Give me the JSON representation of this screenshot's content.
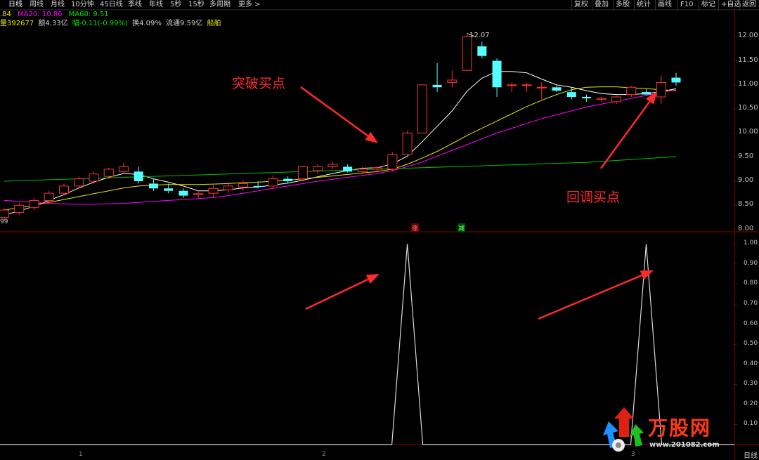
{
  "toolbar": {
    "tabs": [
      "日线",
      "周线",
      "月线",
      "10分钟",
      "45日线",
      "季线",
      "年线",
      "5秒",
      "15秒",
      "多周期",
      "更多 >"
    ],
    "buttons": [
      "复权",
      "叠加",
      "多股",
      "统计",
      "画线",
      "F10",
      "标记",
      "+自选",
      "返回"
    ]
  },
  "ma_row": {
    "ma10": ".84",
    "ma20": "MA20: 10.86",
    "ma60": "MA60: 9.51"
  },
  "info_row": {
    "volume": "量392677",
    "amount": "额4.33亿",
    "change": "幅-0.11(-0.99%)",
    "turnover": "换4.09%",
    "float": "流通9.59亿",
    "sector": "船舶"
  },
  "price_axis": [
    "12.00",
    "11.50",
    "11.00",
    "10.50",
    "10.00",
    "9.50",
    "9.00",
    "8.50",
    "8.00"
  ],
  "indicator_axis": [
    "1.00",
    "0.90",
    "0.80",
    "0.70",
    "0.60",
    "0.50",
    "0.40",
    "0.30",
    "0.20",
    "0.10"
  ],
  "annotations": {
    "breakout": "突破买点",
    "pullback": "回调买点",
    "high": "12.07",
    "low_left": "99"
  },
  "markers": {
    "zhang": "涨",
    "jian": "减"
  },
  "x_ticks": [
    "1",
    "2",
    "3"
  ],
  "period_label": "日线",
  "watermark": {
    "brand": "万股网",
    "url": "www.201082.com"
  },
  "chart_data": [
    {
      "type": "candlestick",
      "title": "",
      "series": [
        {
          "name": "candles",
          "ohlc": [
            [
              8.25,
              8.45,
              8.2,
              8.4
            ],
            [
              8.35,
              8.55,
              8.3,
              8.5
            ],
            [
              8.45,
              8.65,
              8.4,
              8.6
            ],
            [
              8.6,
              8.8,
              8.55,
              8.75
            ],
            [
              8.75,
              8.95,
              8.7,
              8.9
            ],
            [
              8.9,
              9.1,
              8.85,
              9.05
            ],
            [
              9.0,
              9.2,
              8.95,
              9.15
            ],
            [
              9.1,
              9.28,
              9.05,
              9.25
            ],
            [
              9.2,
              9.38,
              9.15,
              9.3
            ],
            [
              9.2,
              9.3,
              8.95,
              9.0
            ],
            [
              8.95,
              9.05,
              8.8,
              8.85
            ],
            [
              8.85,
              8.95,
              8.75,
              8.8
            ],
            [
              8.8,
              8.85,
              8.65,
              8.7
            ],
            [
              8.72,
              8.8,
              8.65,
              8.74
            ],
            [
              8.75,
              8.92,
              8.65,
              8.85
            ],
            [
              8.82,
              8.98,
              8.75,
              8.9
            ],
            [
              8.88,
              9.02,
              8.8,
              8.95
            ],
            [
              8.9,
              9.0,
              8.85,
              8.88
            ],
            [
              8.9,
              9.12,
              8.85,
              9.05
            ],
            [
              9.05,
              9.1,
              8.95,
              9.0
            ],
            [
              9.05,
              9.32,
              9.0,
              9.3
            ],
            [
              9.22,
              9.35,
              9.15,
              9.3
            ],
            [
              9.3,
              9.4,
              9.25,
              9.35
            ],
            [
              9.3,
              9.35,
              9.18,
              9.2
            ],
            [
              9.2,
              9.3,
              9.15,
              9.25
            ],
            [
              9.25,
              9.3,
              9.2,
              9.28
            ],
            [
              9.25,
              9.6,
              9.2,
              9.55
            ],
            [
              9.55,
              10.05,
              9.55,
              10.0
            ],
            [
              10.0,
              11.0,
              10.0,
              11.0
            ],
            [
              11.0,
              11.45,
              10.85,
              10.95
            ],
            [
              11.05,
              11.3,
              10.95,
              11.1
            ],
            [
              11.3,
              12.07,
              11.3,
              12.0
            ],
            [
              11.8,
              11.9,
              11.55,
              11.6
            ],
            [
              11.5,
              11.55,
              10.75,
              10.95
            ],
            [
              11.0,
              11.05,
              10.85,
              11.0
            ],
            [
              11.0,
              11.05,
              10.85,
              11.0
            ],
            [
              10.95,
              11.05,
              10.7,
              10.95
            ],
            [
              10.95,
              10.98,
              10.85,
              10.88
            ],
            [
              10.85,
              10.95,
              10.7,
              10.75
            ],
            [
              10.75,
              10.8,
              10.65,
              10.72
            ],
            [
              10.7,
              10.75,
              10.65,
              10.72
            ],
            [
              10.65,
              10.78,
              10.6,
              10.75
            ],
            [
              10.8,
              10.98,
              10.75,
              10.95
            ],
            [
              10.85,
              10.92,
              10.78,
              10.8
            ],
            [
              10.75,
              11.2,
              10.6,
              11.05
            ],
            [
              11.15,
              11.25,
              10.98,
              11.05
            ]
          ]
        },
        {
          "name": "MA5",
          "values": [
            8.3,
            8.38,
            8.48,
            8.6,
            8.72,
            8.86,
            8.98,
            9.08,
            9.16,
            9.14,
            9.05,
            8.98,
            8.9,
            8.8,
            8.8,
            8.82,
            8.86,
            8.88,
            8.92,
            8.96,
            9.02,
            9.09,
            9.16,
            9.22,
            9.27,
            9.28,
            9.36,
            9.52,
            9.82,
            10.14,
            10.46,
            10.87,
            11.14,
            11.28,
            11.28,
            11.25,
            11.12,
            11.0,
            10.95,
            10.88,
            10.82,
            10.8,
            10.8,
            10.82,
            10.86,
            10.92
          ]
        },
        {
          "name": "MA20",
          "values": [
            8.4,
            8.45,
            8.5,
            8.56,
            8.62,
            8.68,
            8.74,
            8.8,
            8.86,
            8.9,
            8.92,
            8.93,
            8.93,
            8.93,
            8.94,
            8.95,
            8.97,
            8.98,
            9.0,
            9.02,
            9.05,
            9.08,
            9.11,
            9.14,
            9.17,
            9.2,
            9.25,
            9.35,
            9.48,
            9.62,
            9.78,
            9.95,
            10.1,
            10.25,
            10.4,
            10.55,
            10.68,
            10.8,
            10.9,
            10.95,
            10.96,
            10.96,
            10.94,
            10.92,
            10.9,
            10.88
          ]
        },
        {
          "name": "MA60",
          "values": [
            8.6,
            8.58,
            8.56,
            8.54,
            8.53,
            8.52,
            8.52,
            8.53,
            8.54,
            8.56,
            8.58,
            8.6,
            8.62,
            8.64,
            8.66,
            8.7,
            8.75,
            8.8,
            8.85,
            8.9,
            8.95,
            9.0,
            9.04,
            9.08,
            9.12,
            9.16,
            9.22,
            9.3,
            9.4,
            9.52,
            9.64,
            9.76,
            9.88,
            10.0,
            10.1,
            10.2,
            10.3,
            10.38,
            10.46,
            10.54,
            10.6,
            10.66,
            10.72,
            10.78,
            10.84,
            10.9
          ]
        },
        {
          "name": "MA120",
          "values": [
            9.0,
            9.01,
            9.02,
            9.03,
            9.04,
            9.05,
            9.06,
            9.07,
            9.08,
            9.09,
            9.1,
            9.11,
            9.12,
            9.13,
            9.14,
            9.15,
            9.16,
            9.17,
            9.18,
            9.19,
            9.2,
            9.21,
            9.22,
            9.23,
            9.24,
            9.25,
            9.26,
            9.27,
            9.28,
            9.29,
            9.3,
            9.31,
            9.32,
            9.33,
            9.34,
            9.35,
            9.36,
            9.37,
            9.38,
            9.39,
            9.41,
            9.43,
            9.45,
            9.47,
            9.49,
            9.51
          ]
        }
      ],
      "ylim": [
        7.95,
        12.15
      ]
    },
    {
      "type": "line",
      "title": "",
      "series": [
        {
          "name": "signal",
          "values": [
            0,
            0,
            0,
            0,
            0,
            0,
            0,
            0,
            0,
            0,
            0,
            0,
            0,
            0,
            0,
            0,
            0,
            0,
            0,
            0,
            0,
            0,
            0,
            0,
            0,
            0,
            0,
            1,
            0,
            0,
            0,
            0,
            0,
            0,
            0,
            0,
            0,
            0,
            0,
            0,
            0,
            0,
            0,
            1,
            0,
            0
          ]
        }
      ],
      "ylim": [
        0,
        1.05
      ]
    }
  ],
  "colors": {
    "up": "#ff3232",
    "down": "#54ffff",
    "ma5": "#ffffff",
    "ma20": "#e8e800",
    "ma60": "#ff00ff",
    "ma120": "#00c000",
    "annotation": "#ff2a2a",
    "grid": "#8b0000"
  }
}
